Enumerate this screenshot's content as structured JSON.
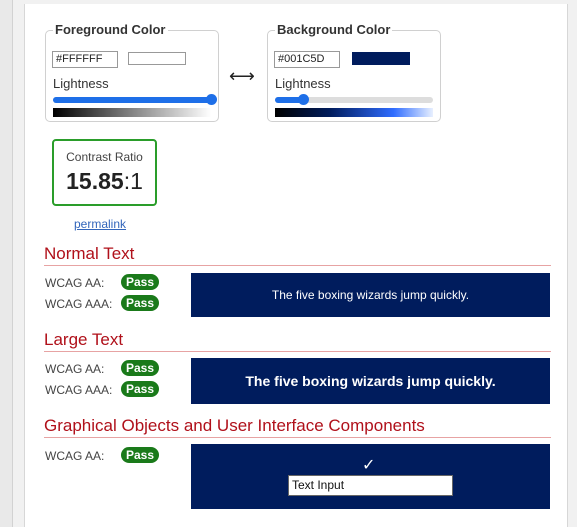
{
  "foreground": {
    "legend": "Foreground Color",
    "hex": "#FFFFFF",
    "swatch_color": "#ffffff",
    "lightness_label": "Lightness",
    "lightness": 1.0
  },
  "background": {
    "legend": "Background Color",
    "hex": "#001C5D",
    "swatch_color": "#001c5d",
    "lightness_label": "Lightness",
    "lightness": 0.18
  },
  "swap_icon": "⟷",
  "contrast": {
    "label": "Contrast Ratio",
    "ratio": "15.85",
    "suffix": ":1",
    "border_color": "#2a9d2a"
  },
  "permalink": "permalink",
  "sections": {
    "normal": {
      "title": "Normal Text",
      "aa_label": "WCAG AA:",
      "aa_result": "Pass",
      "aaa_label": "WCAG AAA:",
      "aaa_result": "Pass",
      "preview_text": "The five boxing wizards jump quickly."
    },
    "large": {
      "title": "Large Text",
      "aa_label": "WCAG AA:",
      "aa_result": "Pass",
      "aaa_label": "WCAG AAA:",
      "aaa_result": "Pass",
      "preview_text": "The five boxing wizards jump quickly."
    },
    "ui": {
      "title": "Graphical Objects and User Interface Components",
      "aa_label": "WCAG AA:",
      "aa_result": "Pass",
      "check_icon": "✓",
      "input_value": "Text Input"
    }
  },
  "colors": {
    "accent_red": "#b0101a",
    "pass_green": "#1a7a1a",
    "link_blue": "#3366bb",
    "slider_blue": "#1e6fe8"
  }
}
